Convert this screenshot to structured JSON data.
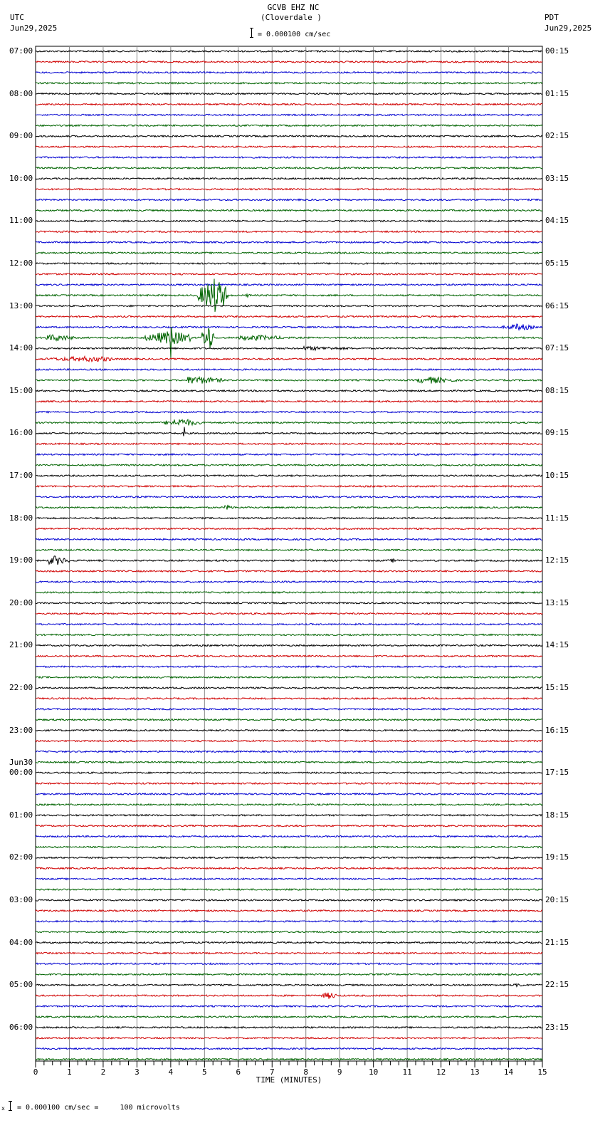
{
  "header": {
    "station": "GCVB EHZ NC",
    "location": "(Cloverdale )",
    "left_tz": "UTC",
    "left_date": "Jun29,2025",
    "right_tz": "PDT",
    "right_date": "Jun29,2025",
    "scale_text": "= 0.000100 cm/sec"
  },
  "footer": {
    "scale_text": "= 0.000100 cm/sec =     100 microvolts"
  },
  "chart_data": {
    "type": "line",
    "title": "GCVB EHZ NC (Cloverdale )",
    "xlabel": "TIME (MINUTES)",
    "xlim": [
      0,
      15
    ],
    "x_ticks": [
      "0",
      "1",
      "2",
      "3",
      "4",
      "5",
      "6",
      "7",
      "8",
      "9",
      "10",
      "11",
      "12",
      "13",
      "14",
      "15"
    ],
    "traces_per_hour": 4,
    "trace_colors": [
      "#000000",
      "#d00000",
      "#0000d0",
      "#006400"
    ],
    "grid": true,
    "utc_labels": [
      "07:00",
      "08:00",
      "09:00",
      "10:00",
      "11:00",
      "12:00",
      "13:00",
      "14:00",
      "15:00",
      "16:00",
      "17:00",
      "18:00",
      "19:00",
      "20:00",
      "21:00",
      "22:00",
      "23:00",
      "00:00",
      "01:00",
      "02:00",
      "03:00",
      "04:00",
      "05:00",
      "06:00"
    ],
    "date_change_label": "Jun30",
    "date_change_index": 17,
    "pdt_labels": [
      "00:15",
      "01:15",
      "02:15",
      "03:15",
      "04:15",
      "05:15",
      "06:15",
      "07:15",
      "08:15",
      "09:15",
      "10:15",
      "11:15",
      "12:15",
      "13:15",
      "14:15",
      "15:15",
      "16:15",
      "17:15",
      "18:15",
      "19:15",
      "20:15",
      "21:15",
      "22:15",
      "23:15"
    ],
    "events": [
      {
        "hour": 5,
        "trace": 3,
        "start": 4.8,
        "end": 5.7,
        "peak": 5.3,
        "relative_amplitude": 25
      },
      {
        "hour": 5,
        "trace": 3,
        "start": 6.2,
        "end": 6.4,
        "peak": 6.3,
        "relative_amplitude": 3
      },
      {
        "hour": 6,
        "trace": 2,
        "start": 13.8,
        "end": 14.8,
        "peak": 14.3,
        "relative_amplitude": 5
      },
      {
        "hour": 6,
        "trace": 3,
        "start": 0.3,
        "end": 1.2,
        "peak": 0.6,
        "relative_amplitude": 5
      },
      {
        "hour": 6,
        "trace": 3,
        "start": 3.2,
        "end": 4.6,
        "peak": 4.0,
        "relative_amplitude": 10
      },
      {
        "hour": 6,
        "trace": 3,
        "start": 4.0,
        "end": 4.05,
        "peak": 4.02,
        "relative_amplitude": 60
      },
      {
        "hour": 6,
        "trace": 3,
        "start": 4.9,
        "end": 5.3,
        "peak": 5.1,
        "relative_amplitude": 20
      },
      {
        "hour": 6,
        "trace": 3,
        "start": 6.0,
        "end": 7.6,
        "peak": 6.5,
        "relative_amplitude": 4
      },
      {
        "hour": 7,
        "trace": 0,
        "start": 7.9,
        "end": 9.7,
        "peak": 8.0,
        "relative_amplitude": 3
      },
      {
        "hour": 7,
        "trace": 1,
        "start": 0.2,
        "end": 2.3,
        "peak": 1.6,
        "relative_amplitude": 4
      },
      {
        "hour": 7,
        "trace": 3,
        "start": 4.5,
        "end": 5.6,
        "peak": 4.7,
        "relative_amplitude": 6
      },
      {
        "hour": 7,
        "trace": 3,
        "start": 11.3,
        "end": 12.5,
        "peak": 11.7,
        "relative_amplitude": 5
      },
      {
        "hour": 8,
        "trace": 3,
        "start": 3.8,
        "end": 4.9,
        "peak": 4.3,
        "relative_amplitude": 6
      },
      {
        "hour": 9,
        "trace": 0,
        "start": 4.38,
        "end": 4.42,
        "peak": 4.4,
        "relative_amplitude": 14
      },
      {
        "hour": 10,
        "trace": 3,
        "start": 5.6,
        "end": 5.9,
        "peak": 5.7,
        "relative_amplitude": 4
      },
      {
        "hour": 12,
        "trace": 0,
        "start": 0.4,
        "end": 1.0,
        "peak": 0.55,
        "relative_amplitude": 7
      },
      {
        "hour": 12,
        "trace": 0,
        "start": 10.4,
        "end": 10.8,
        "peak": 10.6,
        "relative_amplitude": 3
      },
      {
        "hour": 22,
        "trace": 0,
        "start": 14.1,
        "end": 14.5,
        "peak": 14.3,
        "relative_amplitude": 3
      },
      {
        "hour": 22,
        "trace": 1,
        "start": 8.4,
        "end": 8.9,
        "peak": 8.7,
        "relative_amplitude": 5
      }
    ]
  }
}
